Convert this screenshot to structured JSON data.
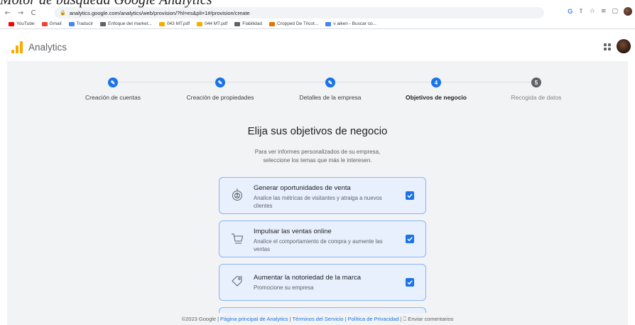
{
  "caption": "Motor de búsqueda Google Analytics",
  "browser": {
    "back_icon": "←",
    "forward_icon": "→",
    "reload_icon": "C",
    "url": "analytics.google.com/analytics/web/provision/?hl=es&pli=1#/provision/create",
    "bookmarks": [
      {
        "label": "YouTube",
        "color": "#ff0000"
      },
      {
        "label": "Gmail",
        "color": "#ea4335"
      },
      {
        "label": "Traducir",
        "color": "#4285f4"
      },
      {
        "label": "Enfoque del market...",
        "color": "#5f6368"
      },
      {
        "label": "043 MT.pdf",
        "color": "#f9ab00"
      },
      {
        "label": "044 MT.pdf",
        "color": "#f9ab00"
      },
      {
        "label": "Fiabilidad",
        "color": "#5f6368"
      },
      {
        "label": "Cropped De Tricot...",
        "color": "#e37400"
      },
      {
        "label": "v aiken - Buscar co...",
        "color": "#4285f4"
      }
    ]
  },
  "header": {
    "app_title": "Analytics"
  },
  "stepper": {
    "steps": [
      {
        "number": "",
        "label": "Creación de cuentas",
        "state": "done"
      },
      {
        "number": "",
        "label": "Creación de propiedades",
        "state": "done"
      },
      {
        "number": "",
        "label": "Detalles de la empresa",
        "state": "done"
      },
      {
        "number": "4",
        "label": "Objetivos de negocio",
        "state": "current"
      },
      {
        "number": "5",
        "label": "Recogida de datos",
        "state": "todo"
      }
    ]
  },
  "main": {
    "title": "Elija sus objetivos de negocio",
    "subtitle_line1": "Para ver informes personalizados de su empresa,",
    "subtitle_line2": "seleccione los temas que más le interesen.",
    "options": [
      {
        "title": "Generar oportunidades de venta",
        "description": "Analice las métricas de visitantes y atraiga a nuevos clientes",
        "icon": "target-person-icon",
        "checked": true
      },
      {
        "title": "Impulsar las ventas online",
        "description": "Analice el comportamiento de compra y aumente las ventas",
        "icon": "shopping-cart-icon",
        "checked": true
      },
      {
        "title": "Aumentar la notoriedad de la marca",
        "description": "Promocione su empresa",
        "icon": "tag-icon",
        "checked": true
      }
    ]
  },
  "footer": {
    "copyright": "©2023 Google",
    "link_home": "Página principal de Analytics",
    "link_terms": "Términos del Servicio",
    "link_privacy": "Política de Privacidad",
    "feedback": "Enviar comentarios"
  },
  "colors": {
    "accent": "#1a73e8",
    "card_bg": "#e8f0fe",
    "logo": "#f9ab00"
  }
}
